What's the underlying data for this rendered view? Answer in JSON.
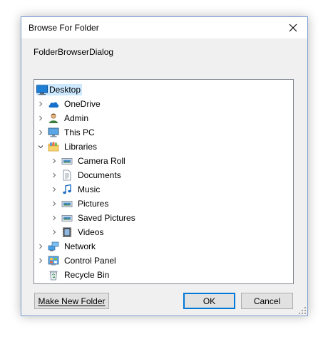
{
  "window": {
    "title": "Browse For Folder",
    "description": "FolderBrowserDialog"
  },
  "tree": [
    {
      "label": "Desktop",
      "icon": "desktop-icon",
      "level": 0,
      "expander": "none",
      "selected": true
    },
    {
      "label": "OneDrive",
      "icon": "cloud-icon",
      "level": 1,
      "expander": "collapsed"
    },
    {
      "label": "Admin",
      "icon": "user-icon",
      "level": 1,
      "expander": "collapsed"
    },
    {
      "label": "This PC",
      "icon": "computer-icon",
      "level": 1,
      "expander": "collapsed"
    },
    {
      "label": "Libraries",
      "icon": "libraries-icon",
      "level": 1,
      "expander": "expanded"
    },
    {
      "label": "Camera Roll",
      "icon": "picture-library-icon",
      "level": 2,
      "expander": "collapsed"
    },
    {
      "label": "Documents",
      "icon": "document-icon",
      "level": 2,
      "expander": "collapsed"
    },
    {
      "label": "Music",
      "icon": "music-icon",
      "level": 2,
      "expander": "collapsed"
    },
    {
      "label": "Pictures",
      "icon": "picture-library-icon",
      "level": 2,
      "expander": "collapsed"
    },
    {
      "label": "Saved Pictures",
      "icon": "picture-library-icon",
      "level": 2,
      "expander": "collapsed"
    },
    {
      "label": "Videos",
      "icon": "video-icon",
      "level": 2,
      "expander": "collapsed"
    },
    {
      "label": "Network",
      "icon": "network-icon",
      "level": 1,
      "expander": "collapsed"
    },
    {
      "label": "Control Panel",
      "icon": "control-panel-icon",
      "level": 1,
      "expander": "collapsed"
    },
    {
      "label": "Recycle Bin",
      "icon": "recycle-bin-icon",
      "level": 1,
      "expander": "none"
    }
  ],
  "buttons": {
    "make_new_folder": "Make New Folder",
    "ok": "OK",
    "cancel": "Cancel"
  },
  "colors": {
    "selection": "#cce8ff",
    "accent": "#0078d7",
    "border": "#828790"
  }
}
